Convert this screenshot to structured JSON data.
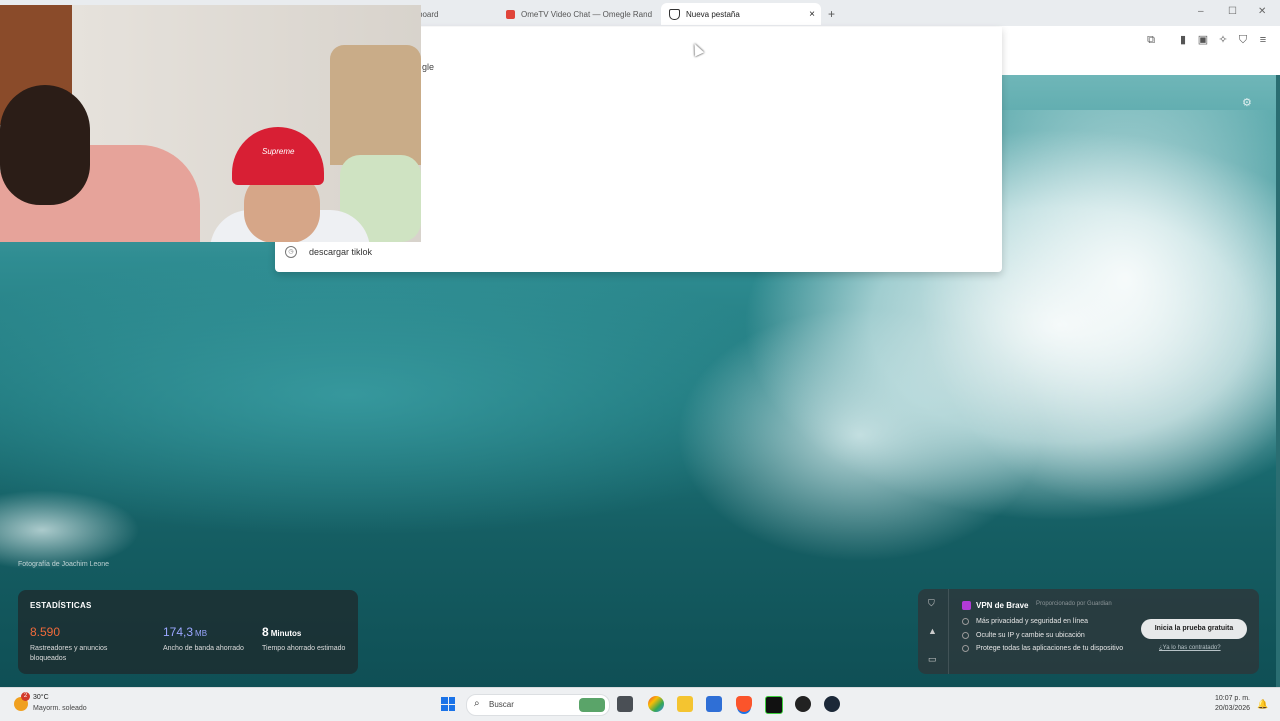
{
  "browser": {
    "tabs": [
      {
        "label": "board",
        "active": false
      },
      {
        "label": "OmeTV Video Chat — Omegle Rand",
        "active": false
      },
      {
        "label": "Nueva pestaña",
        "active": true
      }
    ],
    "new_tab_symbol": "+",
    "close_symbol": "×",
    "window_controls": [
      "–",
      "☐",
      "✕"
    ]
  },
  "omnibox_dropdown": {
    "partial_text": "gle",
    "history_item": "descargar tiklok"
  },
  "new_tab_page": {
    "photo_credit": "Fotografía de Joachim Leone",
    "stats": {
      "title": "ESTADÍSTICAS",
      "items": [
        {
          "value": "8.590",
          "unit": "",
          "desc": "Rastreadores y anuncios bloqueados",
          "color": "#f06a3a"
        },
        {
          "value": "174,3",
          "unit": "MB",
          "desc": "Ancho de banda ahorrado",
          "color": "#9aa7ff"
        },
        {
          "value": "8",
          "unit": "Minutos",
          "desc": "Tiempo ahorrado estimado",
          "color": "#ffffff"
        }
      ]
    },
    "vpn": {
      "title": "VPN de Brave",
      "provided_by": "Proporcionado por Guardian",
      "features": [
        "Más privacidad y seguridad en línea",
        "Oculte su IP y cambie su ubicación",
        "Protege todas las aplicaciones de tu dispositivo"
      ],
      "cta": "Inicia la prueba gratuita",
      "link": "¿Ya lo has contratado?"
    }
  },
  "webcam": {
    "cap_text": "Supreme"
  },
  "taskbar": {
    "weather_badge": "2",
    "temperature": "30°C",
    "condition": "Mayorm. soleado",
    "search_placeholder": "Buscar",
    "time": "10:07 p. m.",
    "date": "20/03/2026"
  }
}
